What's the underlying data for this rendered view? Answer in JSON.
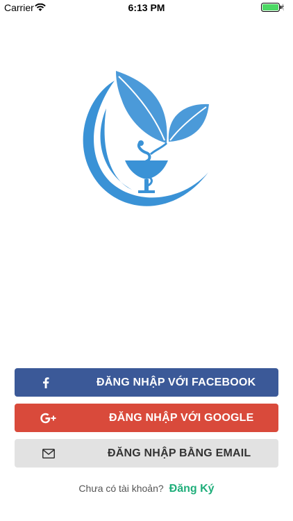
{
  "status_bar": {
    "carrier": "Carrier",
    "time": "6:13 PM"
  },
  "logo": {
    "icon": "pharmacy-leaf-logo",
    "primary_color": "#3a92d6",
    "leaf_color": "#4b9ad9"
  },
  "buttons": {
    "facebook": {
      "label": "ĐĂNG NHẬP VỚI FACEBOOK",
      "icon": "facebook-icon",
      "color": "#3b5998"
    },
    "google": {
      "label": "ĐĂNG NHẬP VỚI GOOGLE",
      "icon": "google-plus-icon",
      "color": "#d94a3b"
    },
    "email": {
      "label": "ĐĂNG NHẬP BẰNG EMAIL",
      "icon": "mail-icon",
      "color": "#e2e2e2"
    }
  },
  "signup": {
    "question": "Chưa có tài khoản?",
    "link_label": "Đăng Ký",
    "link_color": "#1fae7a"
  }
}
